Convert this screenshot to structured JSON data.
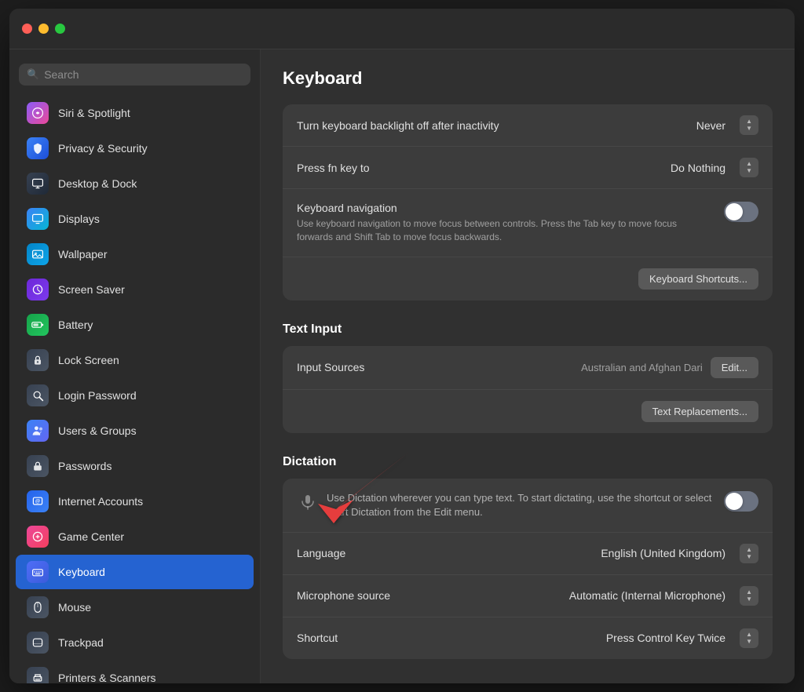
{
  "window": {
    "title": "Keyboard",
    "traffic_lights": {
      "close": "close",
      "minimize": "minimize",
      "maximize": "maximize"
    }
  },
  "sidebar": {
    "search_placeholder": "Search",
    "items": [
      {
        "id": "siri-spotlight",
        "label": "Siri & Spotlight",
        "icon": "siri",
        "icon_char": "🎙",
        "active": false
      },
      {
        "id": "privacy-security",
        "label": "Privacy & Security",
        "icon": "privacy",
        "icon_char": "🖐",
        "active": false
      },
      {
        "id": "desktop-dock",
        "label": "Desktop & Dock",
        "icon": "desktop",
        "icon_char": "🖥",
        "active": false
      },
      {
        "id": "displays",
        "label": "Displays",
        "icon": "displays",
        "icon_char": "💠",
        "active": false
      },
      {
        "id": "wallpaper",
        "label": "Wallpaper",
        "icon": "wallpaper",
        "icon_char": "🖼",
        "active": false
      },
      {
        "id": "screen-saver",
        "label": "Screen Saver",
        "icon": "screensaver",
        "icon_char": "✨",
        "active": false
      },
      {
        "id": "battery",
        "label": "Battery",
        "icon": "battery",
        "icon_char": "🔋",
        "active": false
      },
      {
        "id": "lock-screen",
        "label": "Lock Screen",
        "icon": "lockscreen",
        "icon_char": "🔒",
        "active": false
      },
      {
        "id": "login-password",
        "label": "Login Password",
        "icon": "loginpw",
        "icon_char": "🔑",
        "active": false
      },
      {
        "id": "users-groups",
        "label": "Users & Groups",
        "icon": "users",
        "icon_char": "👥",
        "active": false
      },
      {
        "id": "passwords",
        "label": "Passwords",
        "icon": "passwords",
        "icon_char": "🔑",
        "active": false
      },
      {
        "id": "internet-accounts",
        "label": "Internet Accounts",
        "icon": "internet",
        "icon_char": "@",
        "active": false
      },
      {
        "id": "game-center",
        "label": "Game Center",
        "icon": "gamecenter",
        "icon_char": "🎮",
        "active": false
      },
      {
        "id": "keyboard",
        "label": "Keyboard",
        "icon": "keyboard",
        "icon_char": "⌨",
        "active": true
      },
      {
        "id": "mouse",
        "label": "Mouse",
        "icon": "mouse",
        "icon_char": "🖱",
        "active": false
      },
      {
        "id": "trackpad",
        "label": "Trackpad",
        "icon": "trackpad",
        "icon_char": "⬜",
        "active": false
      },
      {
        "id": "printers-scanners",
        "label": "Printers & Scanners",
        "icon": "printers",
        "icon_char": "🖨",
        "active": false
      }
    ]
  },
  "main": {
    "title": "Keyboard",
    "sections": {
      "keyboard_settings": {
        "rows": [
          {
            "id": "backlight",
            "label": "Turn keyboard backlight off after inactivity",
            "value": "Never",
            "type": "stepper"
          },
          {
            "id": "fn-key",
            "label": "Press fn key to",
            "value": "Do Nothing",
            "type": "stepper"
          },
          {
            "id": "navigation",
            "label": "Keyboard navigation",
            "sublabel": "Use keyboard navigation to move focus between controls. Press the Tab key to move focus forwards and Shift Tab to move focus backwards.",
            "type": "toggle",
            "toggle_on": false
          }
        ],
        "button": "Keyboard Shortcuts..."
      },
      "text_input": {
        "title": "Text Input",
        "rows": [
          {
            "id": "input-sources",
            "label": "Input Sources",
            "value": "Australian and Afghan Dari",
            "type": "button",
            "button_label": "Edit..."
          }
        ],
        "button": "Text Replacements..."
      },
      "dictation": {
        "title": "Dictation",
        "description": "Use Dictation wherever you can type text. To start dictating, use the shortcut or select Start Dictation from the Edit menu.",
        "toggle_on": false,
        "rows": [
          {
            "id": "language",
            "label": "Language",
            "value": "English (United Kingdom)",
            "type": "stepper"
          },
          {
            "id": "microphone-source",
            "label": "Microphone source",
            "value": "Automatic (Internal Microphone)",
            "type": "stepper"
          },
          {
            "id": "shortcut",
            "label": "Shortcut",
            "value": "Press Control Key Twice",
            "type": "stepper"
          }
        ]
      }
    }
  }
}
